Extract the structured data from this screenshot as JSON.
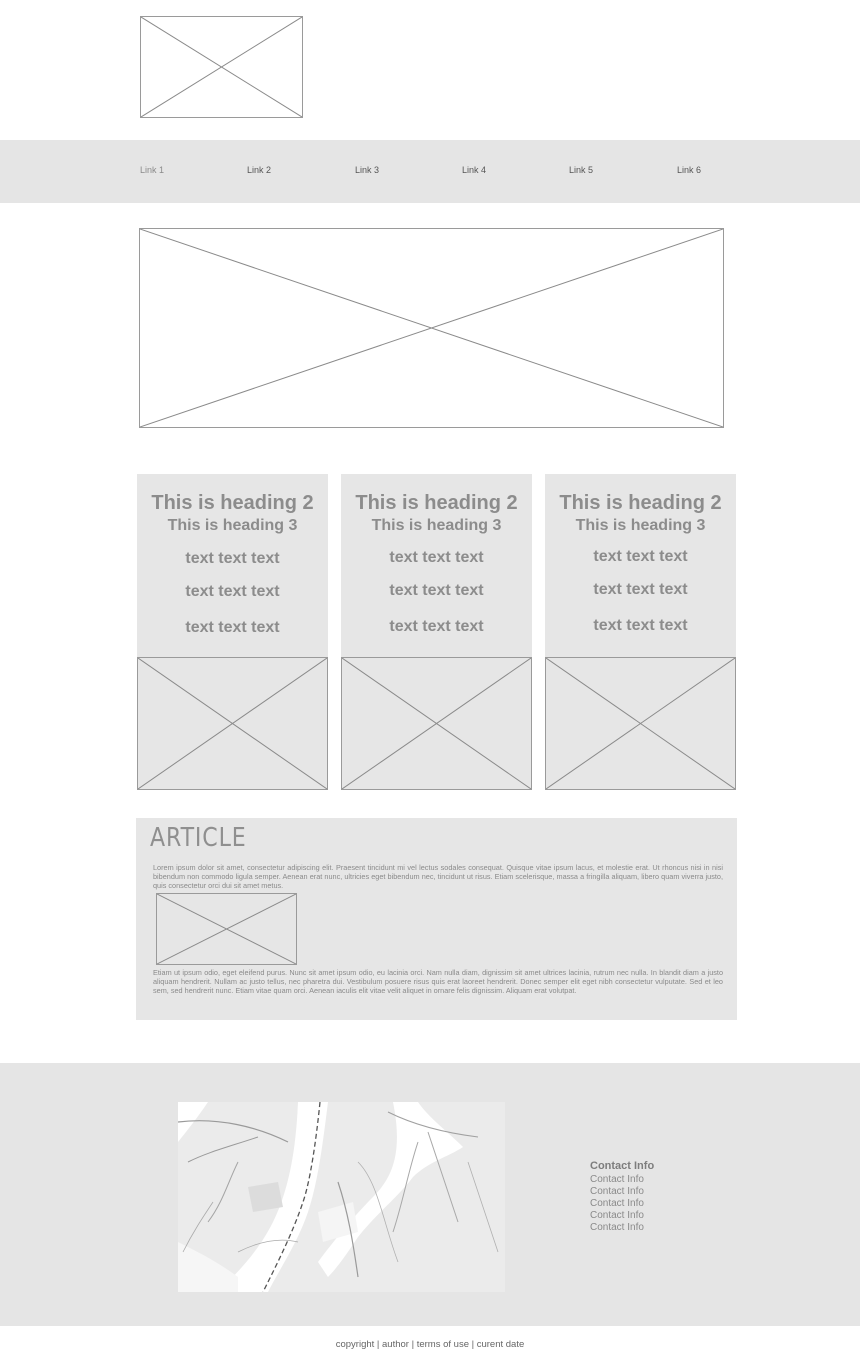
{
  "header": {
    "logo_icon": "image-placeholder-icon"
  },
  "nav": {
    "links": [
      "Link 1",
      "Link 2",
      "Link 3",
      "Link 4",
      "Link 5",
      "Link 6"
    ]
  },
  "hero": {
    "icon": "image-placeholder-icon"
  },
  "cards": [
    {
      "heading2": "This is heading 2",
      "heading3": "This is heading 3",
      "lines": [
        "text text text",
        "text text text",
        "text text text"
      ]
    },
    {
      "heading2": "This is heading 2",
      "heading3": "This is heading 3",
      "lines": [
        "text text text",
        "text text text",
        "text text text"
      ]
    },
    {
      "heading2": "This is heading 2",
      "heading3": "This is heading 3",
      "lines": [
        "text text text",
        "text text text",
        "text text text"
      ]
    }
  ],
  "article": {
    "title": "ARTICLE",
    "paragraph1": "Lorem ipsum dolor sit amet, consectetur adipiscing elit. Praesent tincidunt mi vel lectus sodales consequat. Quisque vitae ipsum lacus, et molestie erat. Ut rhoncus nisi in nisi bibendum non commodo ligula semper. Aenean erat nunc, ultricies eget bibendum nec, tincidunt ut risus. Etiam scelerisque, massa a fringilla aliquam, libero quam viverra justo, quis consectetur orci dui sit amet metus.",
    "paragraph2": "Etiam ut ipsum odio, eget eleifend purus. Nunc sit amet ipsum odio, eu lacinia orci. Nam nulla diam, dignissim sit amet ultrices lacinia, rutrum nec nulla. In blandit diam a justo aliquam hendrerit. Nullam ac justo tellus, nec pharetra dui. Vestibulum posuere risus quis erat laoreet hendrerit. Donec semper elit eget nibh consectetur vulputate. Sed et leo sem, sed hendrerit nunc. Etiam vitae quam orci. Aenean iaculis elit vitae velit aliquet in ornare felis dignissim. Aliquam erat volutpat."
  },
  "footer": {
    "contact_heading": "Contact Info",
    "contact_items": [
      "Contact Info",
      "Contact Info",
      "Contact Info",
      "Contact Info",
      "Contact Info"
    ],
    "copyright": "copyright | author | terms of use | curent date"
  }
}
